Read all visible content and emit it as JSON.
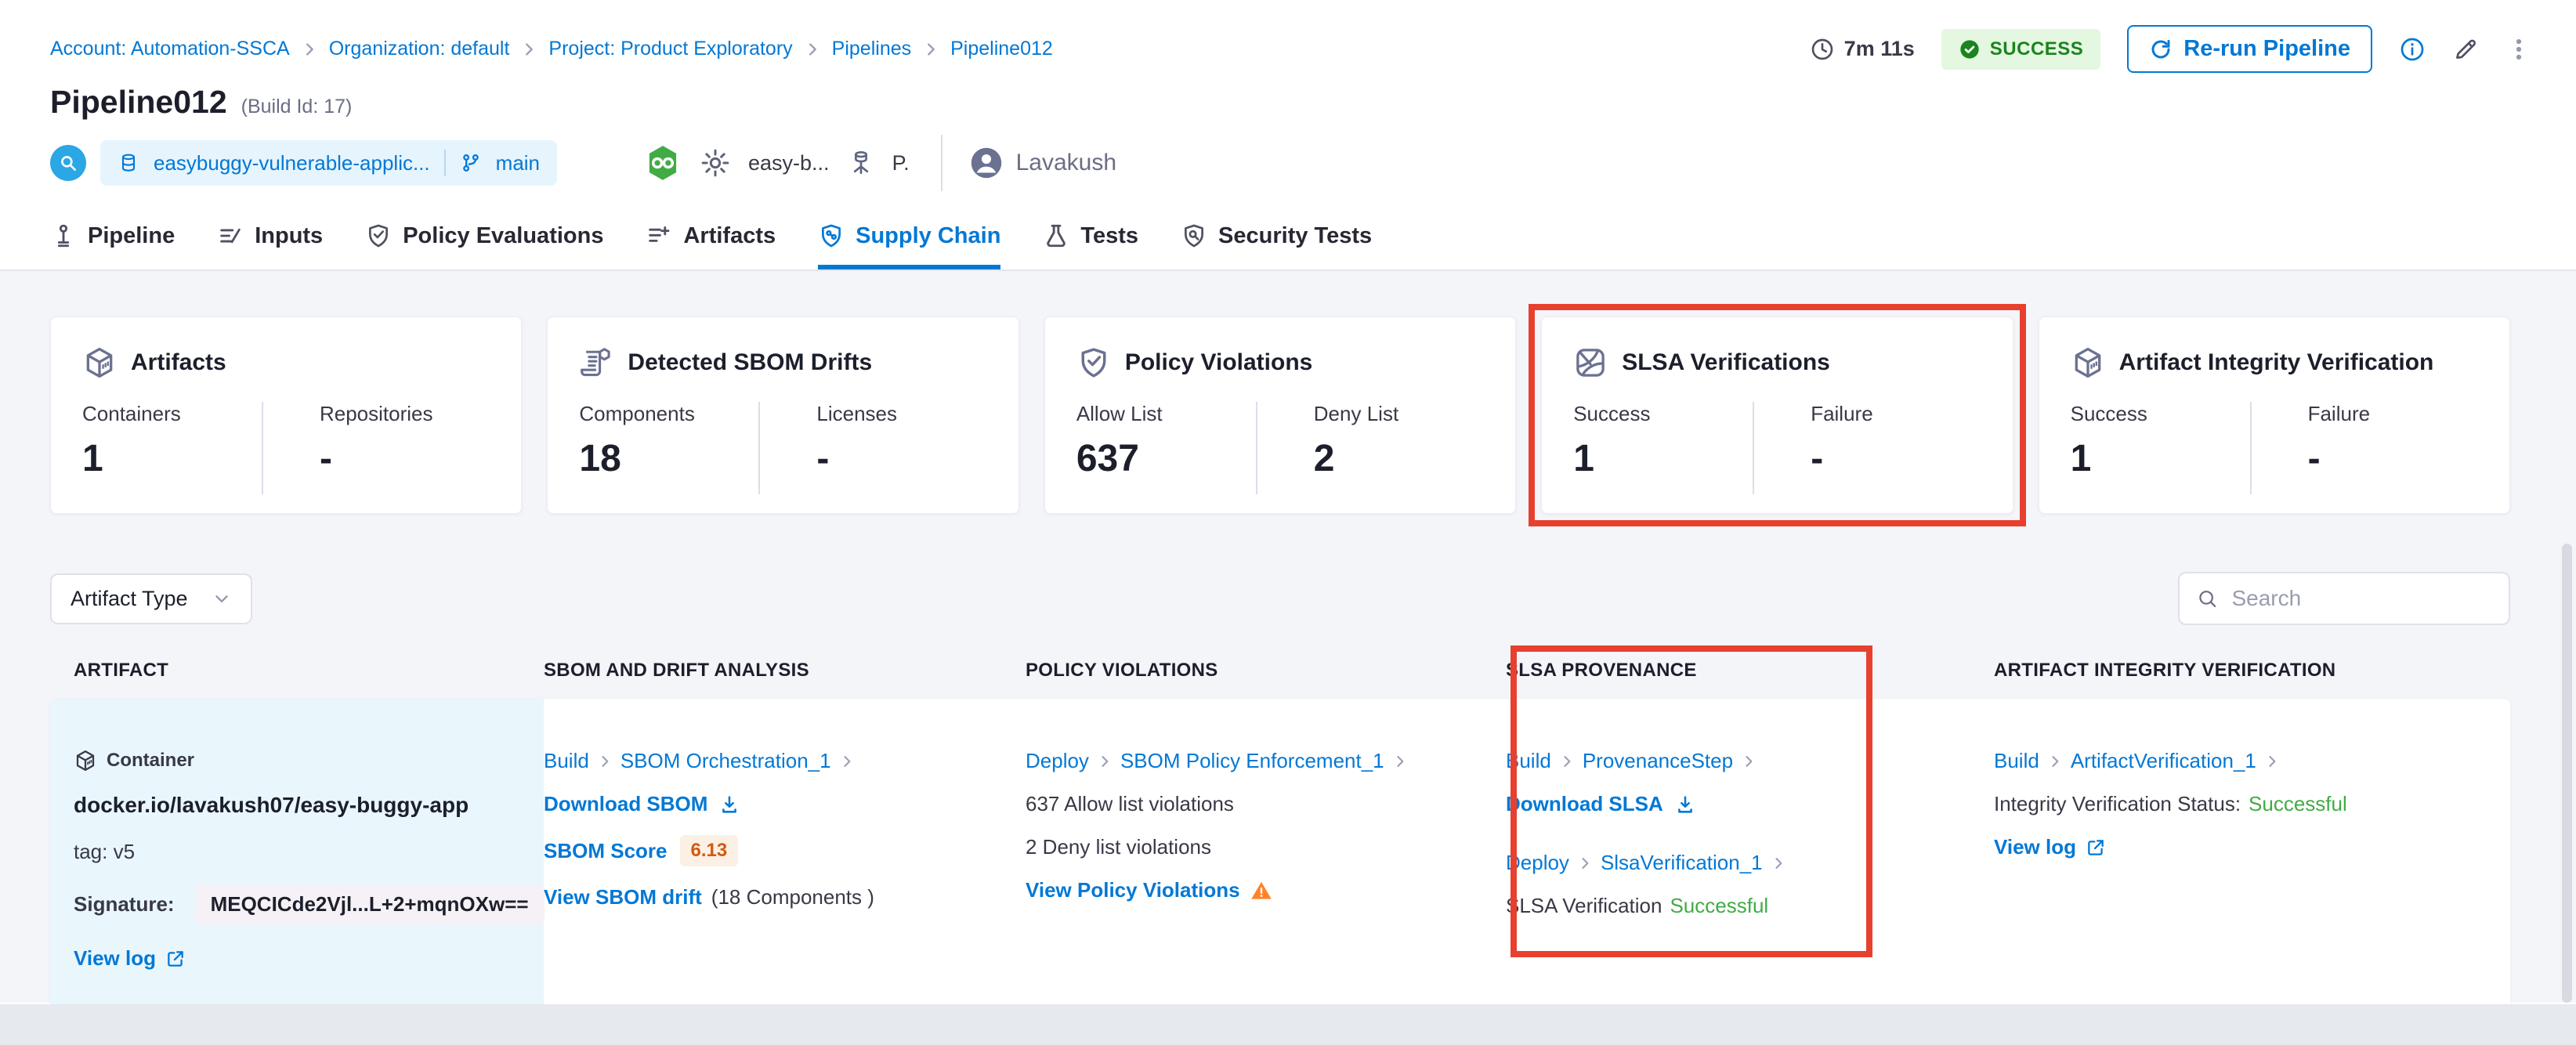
{
  "colors": {
    "accent_blue": "#0278d5",
    "success_green": "#42ab45",
    "success_badge_bg": "#e4f7e1",
    "success_badge_text": "#1b841d",
    "highlight_red": "#e8402f",
    "warning_orange": "#ff832b",
    "score_orange": "#cf5c0f"
  },
  "icons": {
    "duration": "clock-icon",
    "status": "check-circle-icon",
    "rerun": "refresh-icon",
    "search": "magnifier-icon",
    "artifact_cards": "cube-icon",
    "sbom_card": "sbom-scroll-icon",
    "policy_card": "shield-check-icon",
    "slsa_card": "slsa-icon"
  },
  "header": {
    "breadcrumbs": [
      "Account: Automation-SSCA",
      "Organization: default",
      "Project: Product Exploratory",
      "Pipelines",
      "Pipeline012"
    ],
    "duration": "7m 11s",
    "status_label": "SUCCESS",
    "rerun_button": "Re-run Pipeline",
    "title": "Pipeline012",
    "build_id": "(Build Id: 17)",
    "repo_name": "easybuggy-vulnerable-applic...",
    "branch_name": "main",
    "stage_label": "easy-b...",
    "infra_label": "P.",
    "user_name": "Lavakush"
  },
  "tabs": [
    {
      "label": "Pipeline"
    },
    {
      "label": "Inputs"
    },
    {
      "label": "Policy Evaluations"
    },
    {
      "label": "Artifacts"
    },
    {
      "label": "Supply Chain"
    },
    {
      "label": "Tests"
    },
    {
      "label": "Security Tests"
    }
  ],
  "active_tab": "Supply Chain",
  "summary_cards": [
    {
      "title": "Artifacts",
      "stats": [
        {
          "label": "Containers",
          "value": "1"
        },
        {
          "label": "Repositories",
          "value": "-"
        }
      ]
    },
    {
      "title": "Detected SBOM Drifts",
      "stats": [
        {
          "label": "Components",
          "value": "18"
        },
        {
          "label": "Licenses",
          "value": "-"
        }
      ]
    },
    {
      "title": "Policy Violations",
      "stats": [
        {
          "label": "Allow List",
          "value": "637"
        },
        {
          "label": "Deny List",
          "value": "2"
        }
      ]
    },
    {
      "title": "SLSA Verifications",
      "highlighted": true,
      "stats": [
        {
          "label": "Success",
          "value": "1"
        },
        {
          "label": "Failure",
          "value": "-"
        }
      ]
    },
    {
      "title": "Artifact Integrity Verification",
      "stats": [
        {
          "label": "Success",
          "value": "1"
        },
        {
          "label": "Failure",
          "value": "-"
        }
      ]
    }
  ],
  "filters": {
    "artifact_type": "Artifact Type",
    "search_placeholder": "Search"
  },
  "table": {
    "columns": [
      "ARTIFACT",
      "SBOM AND DRIFT ANALYSIS",
      "POLICY VIOLATIONS",
      "SLSA PROVENANCE",
      "ARTIFACT INTEGRITY VERIFICATION"
    ],
    "row": {
      "artifact": {
        "type": "Container",
        "image": "docker.io/lavakush07/easy-buggy-app",
        "tag": "tag: v5",
        "signature_label": "Signature:",
        "signature": "MEQCICde2Vjl...L+2+mqnOXw==",
        "view_log": "View log"
      },
      "sbom": {
        "stage": "Build",
        "step": "SBOM Orchestration_1",
        "download": "Download SBOM",
        "score_label": "SBOM Score",
        "score": "6.13",
        "drift_link": "View SBOM drift",
        "drift_components": "(18 Components )"
      },
      "policy": {
        "stage": "Deploy",
        "step": "SBOM Policy Enforcement_1",
        "allow": "637 Allow list violations",
        "deny": "2 Deny list violations",
        "view": "View Policy Violations"
      },
      "slsa": {
        "prov_stage": "Build",
        "prov_step": "ProvenanceStep",
        "download": "Download SLSA",
        "verify_stage": "Deploy",
        "verify_step": "SlsaVerification_1",
        "status_label": "SLSA Verification",
        "status_value": "Successful"
      },
      "integrity": {
        "stage": "Build",
        "step": "ArtifactVerification_1",
        "status_label": "Integrity Verification Status:",
        "status_value": "Successful",
        "view_log": "View log"
      }
    }
  }
}
